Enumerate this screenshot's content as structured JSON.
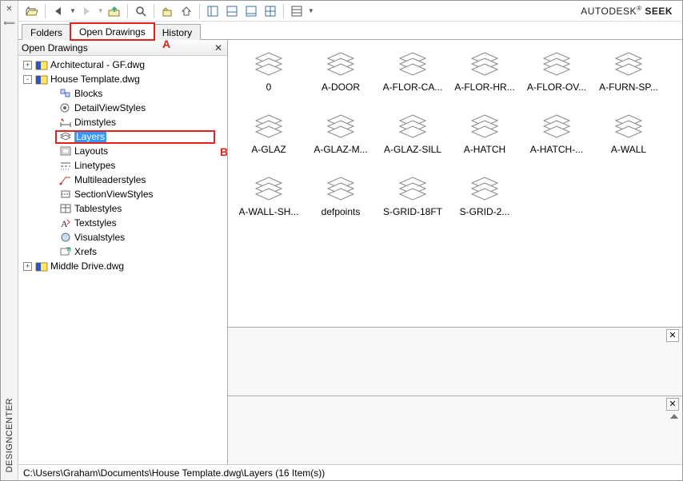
{
  "brand_prefix": "AUTODESK",
  "brand_suffix": "SEEK",
  "rail_title": "DESIGNCENTER",
  "tabs": [
    "Folders",
    "Open Drawings",
    "History"
  ],
  "active_tab_index": 1,
  "pane_title": "Open Drawings",
  "annot_A": "A",
  "annot_B": "B",
  "tree": [
    {
      "indent": 0,
      "twist": "+",
      "icon": "dwg",
      "label": "Architectural - GF.dwg"
    },
    {
      "indent": 0,
      "twist": "-",
      "icon": "dwg",
      "label": "House Template.dwg"
    },
    {
      "indent": 1,
      "twist": "",
      "icon": "blocks",
      "label": "Blocks"
    },
    {
      "indent": 1,
      "twist": "",
      "icon": "detailview",
      "label": "DetailViewStyles"
    },
    {
      "indent": 1,
      "twist": "",
      "icon": "dimstyle",
      "label": "Dimstyles"
    },
    {
      "indent": 1,
      "twist": "",
      "icon": "layers",
      "label": "Layers",
      "selected": true
    },
    {
      "indent": 1,
      "twist": "",
      "icon": "layouts",
      "label": "Layouts"
    },
    {
      "indent": 1,
      "twist": "",
      "icon": "linetypes",
      "label": "Linetypes"
    },
    {
      "indent": 1,
      "twist": "",
      "icon": "mleader",
      "label": "Multileaderstyles"
    },
    {
      "indent": 1,
      "twist": "",
      "icon": "sectionview",
      "label": "SectionViewStyles"
    },
    {
      "indent": 1,
      "twist": "",
      "icon": "tablestyle",
      "label": "Tablestyles"
    },
    {
      "indent": 1,
      "twist": "",
      "icon": "textstyle",
      "label": "Textstyles"
    },
    {
      "indent": 1,
      "twist": "",
      "icon": "visualstyle",
      "label": "Visualstyles"
    },
    {
      "indent": 1,
      "twist": "",
      "icon": "xref",
      "label": "Xrefs"
    },
    {
      "indent": 0,
      "twist": "+",
      "icon": "dwg",
      "label": "Middle Drive.dwg"
    }
  ],
  "layers": [
    "0",
    "A-DOOR",
    "A-FLOR-CA...",
    "A-FLOR-HR...",
    "A-FLOR-OV...",
    "A-FURN-SP...",
    "A-GLAZ",
    "A-GLAZ-M...",
    "A-GLAZ-SILL",
    "A-HATCH",
    "A-HATCH-...",
    "A-WALL",
    "A-WALL-SH...",
    "defpoints",
    "S-GRID-18FT",
    "S-GRID-2..."
  ],
  "status_text": "C:\\Users\\Graham\\Documents\\House Template.dwg\\Layers (16 Item(s))"
}
